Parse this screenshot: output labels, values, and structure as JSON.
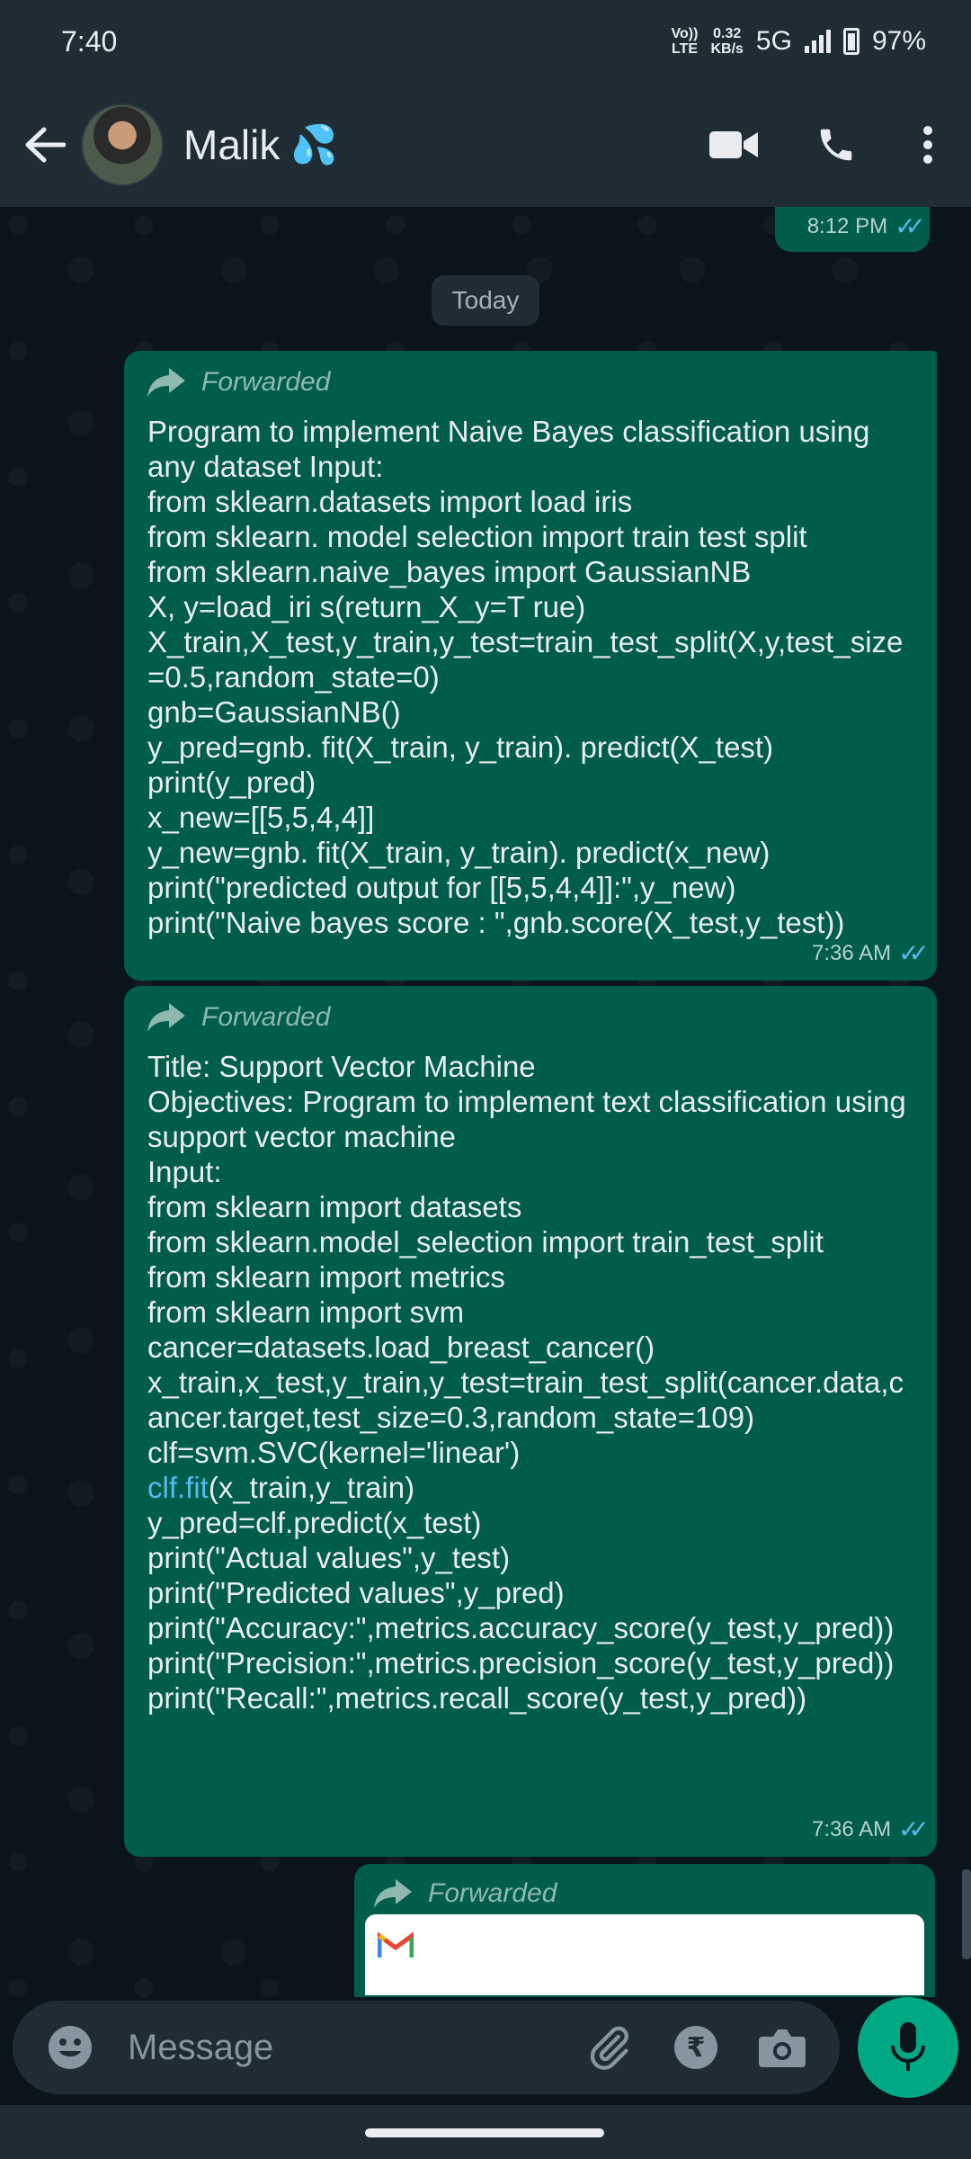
{
  "status_bar": {
    "time": "7:40",
    "network_top": "Vo))",
    "network_bottom": "LTE",
    "speed_value": "0.32",
    "speed_unit": "KB/s",
    "network_type": "5G",
    "battery": "97%"
  },
  "header": {
    "contact_name": "Malik",
    "name_emoji": "💦"
  },
  "chat": {
    "prev_message_time": "8:12 PM",
    "date_divider": "Today",
    "messages": [
      {
        "forwarded_label": "Forwarded",
        "text": "Program to implement Naive Bayes classification using any dataset Input:\nfrom sklearn.datasets import load iris\nfrom sklearn. model selection import train test split\nfrom sklearn.naive_bayes import GaussianNB\nX, y=load_iri s(return_X_y=T rue)\nX_train,X_test,y_train,y_test=train_test_split(X,y,test_size=0.5,random_state=0)\ngnb=GaussianNB()\ny_pred=gnb. fit(X_train, y_train). predict(X_test)\nprint(y_pred)\nx_new=[[5,5,4,4]]\ny_new=gnb. fit(X_train, y_train). predict(x_new)\nprint(\"predicted output for [[5,5,4,4]]:\",y_new)\nprint(\"Naive bayes score : \",gnb.score(X_test,y_test))",
        "time": "7:36 AM"
      },
      {
        "forwarded_label": "Forwarded",
        "text_before_link": "Title: Support Vector Machine\nObjectives: Program to implement text classification using support vector machine\nInput:\nfrom sklearn import datasets\nfrom sklearn.model_selection import train_test_split\nfrom sklearn import metrics\nfrom sklearn import svm\ncancer=datasets.load_breast_cancer()\nx_train,x_test,y_train,y_test=train_test_split(cancer.data,cancer.target,test_size=0.3,random_state=109)\nclf=svm.SVC(kernel='linear')\n",
        "link_text": "clf.fit",
        "text_after_link": "(x_train,y_train)\ny_pred=clf.predict(x_test)\nprint(\"Actual values\",y_test)\nprint(\"Predicted values\",y_pred)\nprint(\"Accuracy:\",metrics.accuracy_score(y_test,y_pred))\nprint(\"Precision:\",metrics.precision_score(y_test,y_pred))\nprint(\"Recall:\",metrics.recall_score(y_test,y_pred))",
        "time": "7:36 AM"
      },
      {
        "forwarded_label": "Forwarded"
      }
    ]
  },
  "input_bar": {
    "placeholder": "Message"
  },
  "colors": {
    "bubble_out": "#005c4b",
    "header_bg": "#1f2c34",
    "accent": "#00a884",
    "read_ticks": "#53bdeb"
  },
  "icons": [
    "back-arrow-icon",
    "video-call-icon",
    "voice-call-icon",
    "more-options-icon",
    "forward-icon",
    "read-ticks-icon",
    "emoji-icon",
    "attach-icon",
    "rupee-payment-icon",
    "camera-icon",
    "mic-icon",
    "gmail-icon"
  ]
}
